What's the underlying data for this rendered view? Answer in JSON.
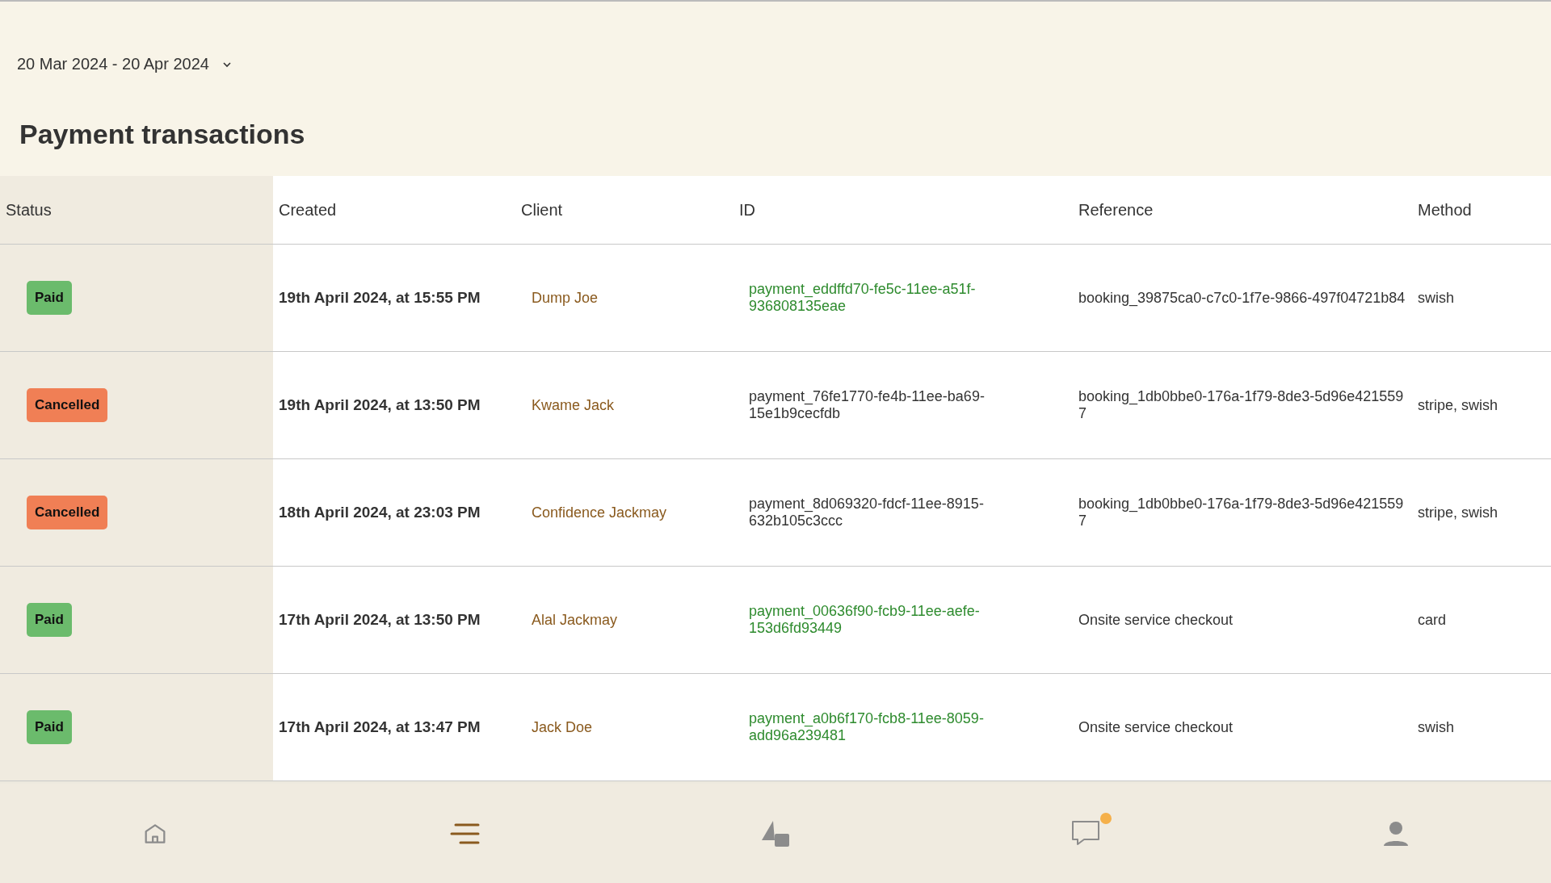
{
  "date_range": {
    "label": "20 Mar 2024 - 20 Apr 2024"
  },
  "title": "Payment transactions",
  "table": {
    "columns": [
      "Status",
      "Created",
      "Client",
      "ID",
      "Reference",
      "Method"
    ],
    "rows": [
      {
        "status": {
          "label": "Paid",
          "kind": "paid"
        },
        "created": "19th April 2024, at 15:55 PM",
        "client": "Dump Joe",
        "id": "payment_eddffd70-fe5c-11ee-a51f-936808135eae",
        "reference": "booking_39875ca0-c7c0-1f7e-9866-497f04721b84",
        "method": "swish"
      },
      {
        "status": {
          "label": "Cancelled",
          "kind": "cancelled"
        },
        "created": "19th April 2024, at 13:50 PM",
        "client": "Kwame Jack",
        "id": "payment_76fe1770-fe4b-11ee-ba69-15e1b9cecfdb",
        "reference": "booking_1db0bbe0-176a-1f79-8de3-5d96e4215597",
        "method": "stripe, swish"
      },
      {
        "status": {
          "label": "Cancelled",
          "kind": "cancelled"
        },
        "created": "18th April 2024, at 23:03 PM",
        "client": "Confidence Jackmay",
        "id": "payment_8d069320-fdcf-11ee-8915-632b105c3ccc",
        "reference": "booking_1db0bbe0-176a-1f79-8de3-5d96e4215597",
        "method": "stripe, swish"
      },
      {
        "status": {
          "label": "Paid",
          "kind": "paid"
        },
        "created": "17th April 2024, at 13:50 PM",
        "client": "Alal Jackmay",
        "id": "payment_00636f90-fcb9-11ee-aefe-153d6fd93449",
        "reference": "Onsite service checkout",
        "method": "card"
      },
      {
        "status": {
          "label": "Paid",
          "kind": "paid"
        },
        "created": "17th April 2024, at 13:47 PM",
        "client": "Jack Doe",
        "id": "payment_a0b6f170-fcb8-11ee-8059-add96a239481",
        "reference": "Onsite service checkout",
        "method": "swish"
      }
    ]
  },
  "bottom_nav": [
    {
      "kind": "home",
      "selected": false,
      "notification": false
    },
    {
      "kind": "list",
      "selected": true,
      "notification": false
    },
    {
      "kind": "shapes",
      "selected": false,
      "notification": false
    },
    {
      "kind": "chat",
      "selected": false,
      "notification": true
    },
    {
      "kind": "person",
      "selected": false,
      "notification": false
    }
  ]
}
